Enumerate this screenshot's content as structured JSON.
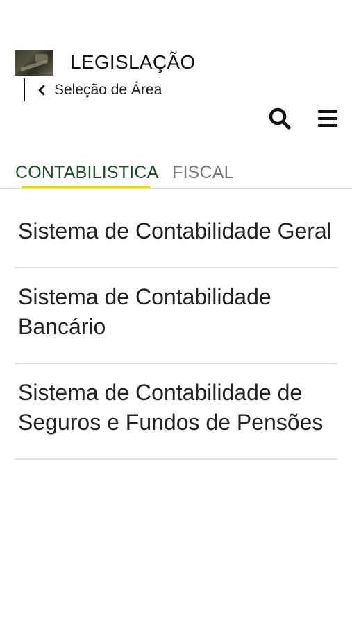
{
  "header": {
    "title": "LEGISLAÇÃO",
    "back_label": "Seleção de Área",
    "icons": {
      "back": "chevron-left-icon",
      "search": "search-icon",
      "menu": "hamburger-menu-icon"
    }
  },
  "tabs": [
    {
      "label": "CONTABILISTICA",
      "active": true
    },
    {
      "label": "FISCAL",
      "active": false
    }
  ],
  "colors": {
    "active_tab": "#1e4d2b",
    "inactive_tab": "#777777",
    "tab_indicator": "#f2d600"
  },
  "items": [
    {
      "label": "Sistema de Contabilidade Geral"
    },
    {
      "label": "Sistema de Contabilidade Bancário"
    },
    {
      "label": "Sistema de Contabilidade de Seguros e Fundos de Pensões"
    }
  ]
}
